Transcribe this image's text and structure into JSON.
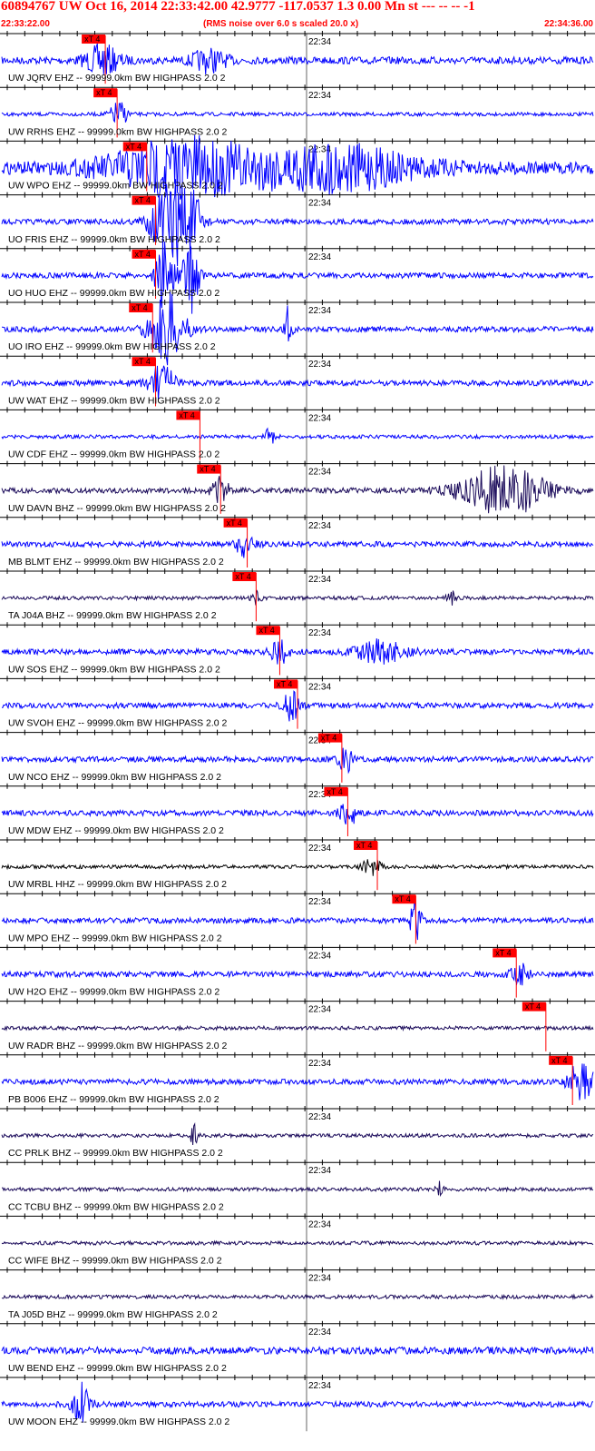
{
  "header": {
    "title": "60894767 UW Oct 16, 2014 22:33:42.00   42.9777 -117.0537  1.3 0.00 Mn st --- -- --  -1",
    "start_time": "22:33:22.00",
    "note": "(RMS noise over 6.0 s scaled 20.0 x)",
    "end_time": "22:34:36.00"
  },
  "colors": {
    "header_text": "#ff0000",
    "pick_box": "#ff0000",
    "axis": "#000000"
  },
  "minute_tick_label": "22:34",
  "pick_label": "xT 4",
  "traces": [
    {
      "label": "UW JQRV EHZ -- 99999.0km BW  HIGHPASS  2.0  2",
      "color": "#0000ff",
      "pick": 0.175,
      "noise": 4,
      "bursts": [
        {
          "t": 0.17,
          "w": 0.02,
          "a": 16
        },
        {
          "t": 0.35,
          "w": 0.02,
          "a": 12
        }
      ]
    },
    {
      "label": "UW RRHS EHZ -- 99999.0km BW  HIGHPASS  2.0  2",
      "color": "#0000ff",
      "pick": 0.195,
      "noise": 2,
      "bursts": [
        {
          "t": 0.198,
          "w": 0.01,
          "a": 14
        }
      ]
    },
    {
      "label": "UW WPO EHZ -- 99999.0km BW  HIGHPASS  2.0  2",
      "color": "#0000ff",
      "pick": 0.245,
      "noise": 7,
      "bursts": [
        {
          "t": 0.3,
          "w": 0.08,
          "a": 30
        },
        {
          "t": 0.55,
          "w": 0.1,
          "a": 24
        }
      ]
    },
    {
      "label": "UO FRIS EHZ -- 99999.0km BW  HIGHPASS  2.0  2",
      "color": "#0000ff",
      "pick": 0.26,
      "noise": 3,
      "bursts": [
        {
          "t": 0.28,
          "w": 0.02,
          "a": 40
        },
        {
          "t": 0.315,
          "w": 0.015,
          "a": 40
        }
      ]
    },
    {
      "label": "UO HUO EHZ -- 99999.0km BW  HIGHPASS  2.0  2",
      "color": "#0000ff",
      "pick": 0.26,
      "noise": 3,
      "bursts": [
        {
          "t": 0.275,
          "w": 0.01,
          "a": 40
        },
        {
          "t": 0.32,
          "w": 0.01,
          "a": 40
        }
      ]
    },
    {
      "label": "UO IRO EHZ -- 99999.0km BW  HIGHPASS  2.0  2",
      "color": "#0000ff",
      "pick": 0.255,
      "noise": 3,
      "bursts": [
        {
          "t": 0.28,
          "w": 0.02,
          "a": 40
        },
        {
          "t": 0.485,
          "w": 0.004,
          "a": 30
        }
      ]
    },
    {
      "label": "UW WAT EHZ -- 99999.0km BW  HIGHPASS  2.0  2",
      "color": "#0000ff",
      "pick": 0.26,
      "noise": 3,
      "bursts": [
        {
          "t": 0.27,
          "w": 0.015,
          "a": 20
        }
      ]
    },
    {
      "label": "UW CDF EHZ -- 99999.0km BW  HIGHPASS  2.0  2",
      "color": "#0000ff",
      "pick": 0.335,
      "noise": 2,
      "bursts": [
        {
          "t": 0.455,
          "w": 0.006,
          "a": 12
        }
      ]
    },
    {
      "label": "UW DAVN BHZ -- 99999.0km BW  HIGHPASS  2.0  2",
      "color": "#1a0a5a",
      "pick": 0.37,
      "noise": 3,
      "bursts": [
        {
          "t": 0.37,
          "w": 0.01,
          "a": 14
        },
        {
          "t": 0.85,
          "w": 0.05,
          "a": 28
        }
      ]
    },
    {
      "label": "MB BLMT EHZ -- 99999.0km BW  HIGHPASS  2.0  2",
      "color": "#0000ff",
      "pick": 0.415,
      "noise": 3,
      "bursts": [
        {
          "t": 0.41,
          "w": 0.01,
          "a": 14
        }
      ]
    },
    {
      "label": "TA J04A BHZ -- 99999.0km BW  HIGHPASS  2.0  2",
      "color": "#1a0a5a",
      "pick": 0.43,
      "noise": 2,
      "bursts": [
        {
          "t": 0.43,
          "w": 0.005,
          "a": 8
        },
        {
          "t": 0.76,
          "w": 0.005,
          "a": 8
        }
      ]
    },
    {
      "label": "UW SOS EHZ -- 99999.0km BW  HIGHPASS  2.0  2",
      "color": "#0000ff",
      "pick": 0.47,
      "noise": 3,
      "bursts": [
        {
          "t": 0.47,
          "w": 0.01,
          "a": 14
        },
        {
          "t": 0.64,
          "w": 0.03,
          "a": 12
        }
      ]
    },
    {
      "label": "UW SVOH EHZ -- 99999.0km BW  HIGHPASS  2.0  2",
      "color": "#0000ff",
      "pick": 0.5,
      "noise": 3,
      "bursts": [
        {
          "t": 0.49,
          "w": 0.01,
          "a": 16
        }
      ]
    },
    {
      "label": "UW NCO EHZ -- 99999.0km BW  HIGHPASS  2.0  2",
      "color": "#0000ff",
      "pick": 0.575,
      "noise": 3,
      "bursts": [
        {
          "t": 0.58,
          "w": 0.01,
          "a": 14
        }
      ]
    },
    {
      "label": "UW MDW EHZ -- 99999.0km BW  HIGHPASS  2.0  2",
      "color": "#0000ff",
      "pick": 0.585,
      "noise": 3,
      "bursts": [
        {
          "t": 0.585,
          "w": 0.01,
          "a": 16
        }
      ]
    },
    {
      "label": "UW MRBL HHZ -- 99999.0km BW  HIGHPASS  2.0  2",
      "color": "#000000",
      "pick": 0.635,
      "noise": 2,
      "bursts": [
        {
          "t": 0.625,
          "w": 0.01,
          "a": 10
        }
      ]
    },
    {
      "label": "UW MPO EHZ -- 99999.0km BW  HIGHPASS  2.0  2",
      "color": "#0000ff",
      "pick": 0.7,
      "noise": 3,
      "bursts": [
        {
          "t": 0.7,
          "w": 0.006,
          "a": 26
        }
      ]
    },
    {
      "label": "UW H2O EHZ -- 99999.0km BW  HIGHPASS  2.0  2",
      "color": "#0000ff",
      "pick": 0.87,
      "noise": 3,
      "bursts": [
        {
          "t": 0.875,
          "w": 0.01,
          "a": 12
        }
      ]
    },
    {
      "label": "UW RADR BHZ -- 99999.0km BW  HIGHPASS  2.0  2",
      "color": "#1a0a5a",
      "pick": 0.92,
      "noise": 2,
      "bursts": []
    },
    {
      "label": "PB B006 EHZ -- 99999.0km BW  HIGHPASS  2.0  2",
      "color": "#0000ff",
      "pick": 0.965,
      "noise": 3,
      "bursts": [
        {
          "t": 0.98,
          "w": 0.015,
          "a": 22
        }
      ]
    },
    {
      "label": "CC PRLK BHZ -- 99999.0km BW  HIGHPASS  2.0  2",
      "color": "#1a0a5a",
      "pick": null,
      "noise": 2,
      "bursts": [
        {
          "t": 0.325,
          "w": 0.004,
          "a": 12
        }
      ]
    },
    {
      "label": "CC TCBU BHZ -- 99999.0km BW  HIGHPASS  2.0  2",
      "color": "#1a0a5a",
      "pick": null,
      "noise": 2,
      "bursts": [
        {
          "t": 0.74,
          "w": 0.004,
          "a": 10
        }
      ]
    },
    {
      "label": "CC WIFE BHZ -- 99999.0km BW  HIGHPASS  2.0  2",
      "color": "#1a0a5a",
      "pick": null,
      "noise": 2,
      "bursts": []
    },
    {
      "label": "TA J05D BHZ -- 99999.0km BW  HIGHPASS  2.0  2",
      "color": "#1a0a5a",
      "pick": null,
      "noise": 2,
      "bursts": []
    },
    {
      "label": "UW BEND EHZ -- 99999.0km BW  HIGHPASS  2.0  2",
      "color": "#0000ff",
      "pick": null,
      "noise": 4,
      "bursts": []
    },
    {
      "label": "UW MOON EHZ -- 99999.0km BW  HIGHPASS  2.0  2",
      "color": "#0000ff",
      "pick": null,
      "noise": 3,
      "bursts": [
        {
          "t": 0.135,
          "w": 0.01,
          "a": 22
        }
      ]
    }
  ]
}
